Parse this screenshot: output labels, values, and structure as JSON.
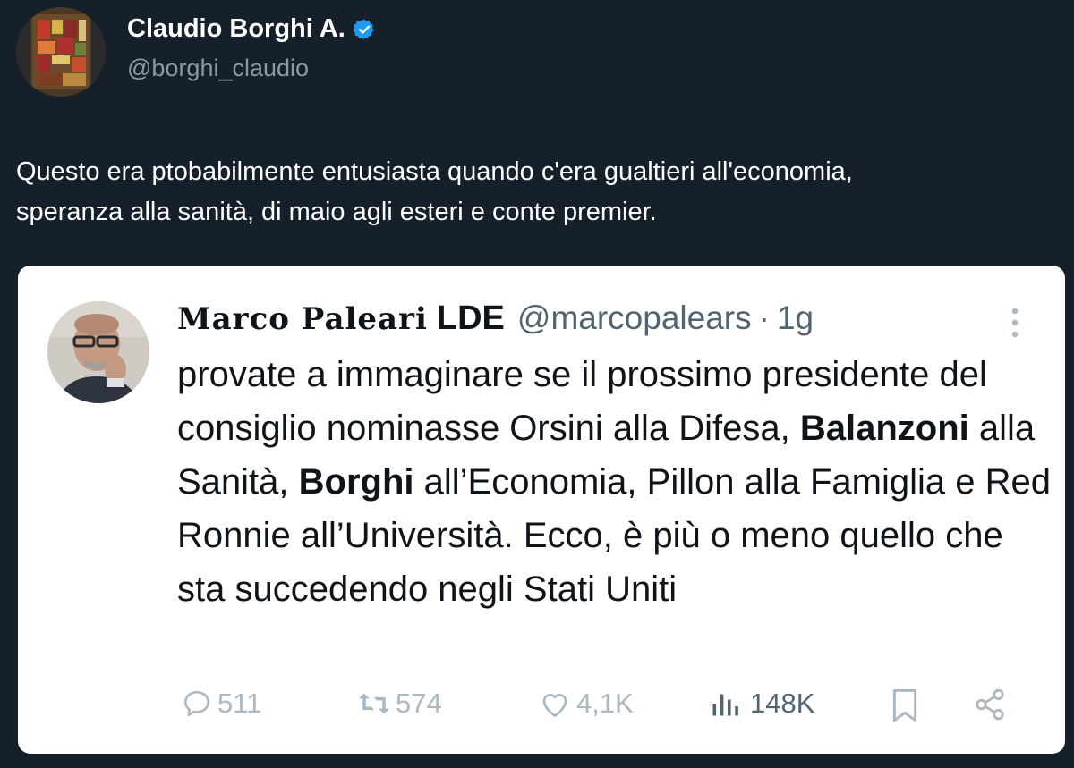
{
  "author": {
    "name": "Claudio Borghi A.",
    "handle": "@borghi_claudio",
    "verified": true
  },
  "tweet": {
    "text_line1": "Questo era ptobabilmente entusiasta quando c'era gualtieri all'economia,",
    "text_line2": "speranza alla sanità, di maio agli esteri e conte premier."
  },
  "quoted": {
    "name": "Marco Paleari",
    "name_suffix": "LDE",
    "handle": "@marcopalears",
    "separator": "·",
    "time": "1g",
    "text": {
      "p1": "provate a immaginare se il prossimo presidente del consiglio nominasse Orsini alla Difesa, ",
      "b1": "Balanzoni",
      "p2": " alla Sanità, ",
      "b2": "Borghi",
      "p3": " all’Economia, Pillon alla Famiglia e Red Ronnie all’Università. Ecco, è più o meno quello che sta succedendo negli Stati Uniti"
    },
    "actions": {
      "replies": "511",
      "retweets": "574",
      "likes": "4,1K",
      "views": "148K"
    }
  },
  "icons": {
    "verified": "verified-badge-icon",
    "more": "more-vertical-icon",
    "reply": "reply-icon",
    "retweet": "retweet-icon",
    "like": "heart-icon",
    "views": "views-bar-icon",
    "bookmark": "bookmark-icon",
    "share": "share-icon"
  },
  "colors": {
    "background": "#15202b",
    "verified": "#1d9bf0",
    "card": "#ffffff"
  }
}
